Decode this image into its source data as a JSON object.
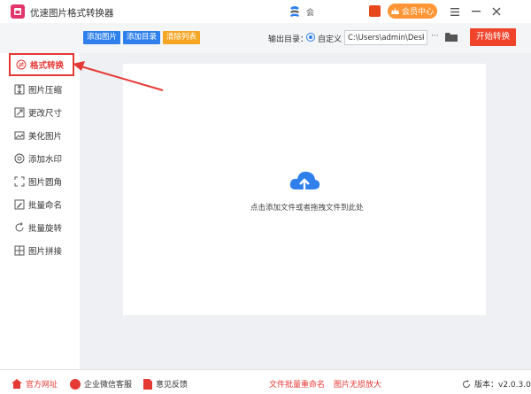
{
  "window": {
    "title": "优速图片格式转换器",
    "user_name": "会",
    "member_label": "会员中心"
  },
  "toolbar": {
    "add_image": "添加图片",
    "add_folder": "添加目录",
    "clear_list": "清除列表",
    "output_dir_label": "输出目录：",
    "custom_radio": "自定义",
    "path_value": "C:\\Users\\admin\\Deskto",
    "more": "···",
    "start": "开始转换",
    "colors": {
      "add_image": "#2f80ed",
      "add_folder": "#2f80ed",
      "clear_list": "#f5a623",
      "start": "#f0442b"
    }
  },
  "sidebar": {
    "items": [
      {
        "label": "格式转换",
        "icon": "convert-icon",
        "active": true
      },
      {
        "label": "图片压缩",
        "icon": "compress-icon"
      },
      {
        "label": "更改尺寸",
        "icon": "resize-icon"
      },
      {
        "label": "美化图片",
        "icon": "beautify-icon"
      },
      {
        "label": "添加水印",
        "icon": "watermark-icon"
      },
      {
        "label": "图片圆角",
        "icon": "round-corner-icon"
      },
      {
        "label": "批量命名",
        "icon": "rename-icon"
      },
      {
        "label": "批量旋转",
        "icon": "rotate-icon"
      },
      {
        "label": "图片拼接",
        "icon": "stitch-icon"
      }
    ]
  },
  "main": {
    "drop_hint": "点击添加文件或者拖拽文件到此处"
  },
  "footer": {
    "website": "官方网址",
    "wechat": "企业微信客服",
    "feedback": "意见反馈",
    "batch_rename": "文件批量重命名",
    "lossless_enlarge": "图片无损放大",
    "version": "版本：v2.0.3.0"
  }
}
